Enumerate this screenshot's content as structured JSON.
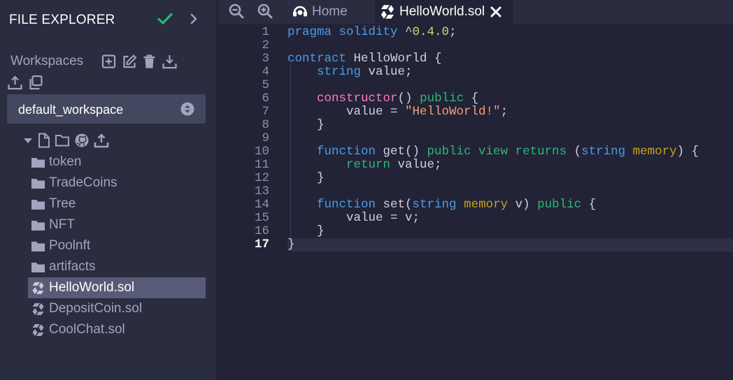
{
  "sidebar": {
    "title": "FILE EXPLORER",
    "workspaces_label": "Workspaces",
    "workspace_select": {
      "value": "default_workspace"
    },
    "items": [
      {
        "label": "token",
        "type": "folder"
      },
      {
        "label": "TradeCoins",
        "type": "folder"
      },
      {
        "label": "Tree",
        "type": "folder"
      },
      {
        "label": "NFT",
        "type": "folder"
      },
      {
        "label": "Poolnft",
        "type": "folder"
      },
      {
        "label": "artifacts",
        "type": "folder"
      },
      {
        "label": "HelloWorld.sol",
        "type": "solidity-file",
        "selected": true
      },
      {
        "label": "DepositCoin.sol",
        "type": "solidity-file"
      },
      {
        "label": "CoolChat.sol",
        "type": "solidity-file"
      }
    ]
  },
  "tabs": {
    "home_label": "Home",
    "file_label": "HelloWorld.sol"
  },
  "editor": {
    "active_line": 17,
    "line_numbers": [
      "1",
      "2",
      "3",
      "4",
      "5",
      "6",
      "7",
      "8",
      "9",
      "10",
      "11",
      "12",
      "13",
      "14",
      "15",
      "16",
      "17"
    ],
    "lines": [
      [
        [
          "kw",
          "pragma solidity "
        ],
        [
          "txt",
          "^"
        ],
        [
          "num",
          "0.4.0"
        ],
        [
          "txt",
          ";"
        ]
      ],
      [],
      [
        [
          "kw",
          "contract "
        ],
        [
          "txt",
          "HelloWorld {"
        ]
      ],
      [
        [
          "txt",
          "    "
        ],
        [
          "kw",
          "string "
        ],
        [
          "txt",
          "value;"
        ]
      ],
      [],
      [
        [
          "txt",
          "    "
        ],
        [
          "ctor",
          "constructor"
        ],
        [
          "txt",
          "() "
        ],
        [
          "mod",
          "public"
        ],
        [
          "txt",
          " {"
        ]
      ],
      [
        [
          "txt",
          "        value = "
        ],
        [
          "str",
          "\"HelloWorld!\""
        ],
        [
          "txt",
          ";"
        ]
      ],
      [
        [
          "txt",
          "    }"
        ]
      ],
      [],
      [
        [
          "txt",
          "    "
        ],
        [
          "kw",
          "function "
        ],
        [
          "txt",
          "get() "
        ],
        [
          "mod",
          "public view returns"
        ],
        [
          "txt",
          " ("
        ],
        [
          "kw",
          "string "
        ],
        [
          "mem",
          "memory"
        ],
        [
          "txt",
          ") {"
        ]
      ],
      [
        [
          "txt",
          "        "
        ],
        [
          "mod",
          "return "
        ],
        [
          "txt",
          "value;"
        ]
      ],
      [
        [
          "txt",
          "    }"
        ]
      ],
      [],
      [
        [
          "txt",
          "    "
        ],
        [
          "kw",
          "function "
        ],
        [
          "txt",
          "set("
        ],
        [
          "kw",
          "string "
        ],
        [
          "mem",
          "memory "
        ],
        [
          "txt",
          "v) "
        ],
        [
          "mod",
          "public"
        ],
        [
          "txt",
          " {"
        ]
      ],
      [
        [
          "txt",
          "        value = v;"
        ]
      ],
      [
        [
          "txt",
          "    }"
        ]
      ],
      [
        [
          "txt",
          "}"
        ]
      ]
    ]
  },
  "colors": {
    "sidebar_bg": "#2a2c3f",
    "editor_bg": "#222336",
    "selected_item_bg": "#585b78",
    "check_green": "#2fb67a",
    "keyword_blue": "#4a9ce8"
  }
}
